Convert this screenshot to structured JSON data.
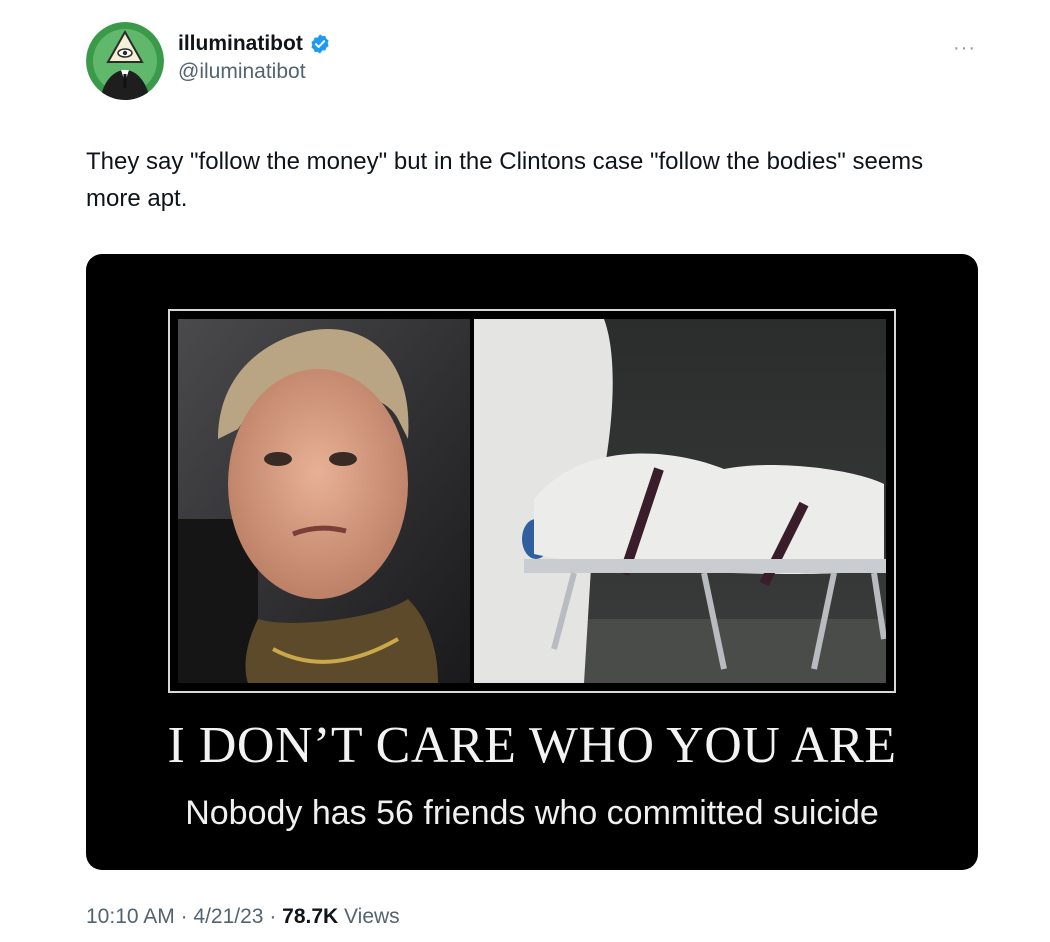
{
  "author": {
    "display_name": "illuminatibot",
    "handle": "@iluminatibot",
    "verified": true,
    "avatar_icon": "illuminati-eye-pyramid-icon"
  },
  "menu": {
    "more_label": "···"
  },
  "tweet": {
    "text": "They say \"follow the money\" but in the Clintons case \"follow the bodies\" seems more apt."
  },
  "media": {
    "headline": "I DON’T CARE WHO YOU ARE",
    "subline": "Nobody has 56 friends who committed suicide"
  },
  "meta": {
    "time": "10:10 AM",
    "sep1": " · ",
    "date": "4/21/23",
    "sep2": " · ",
    "views_count": "78.7K",
    "views_label": " Views"
  },
  "colors": {
    "verified_blue": "#1d9bf0",
    "avatar_green": "#3b9a4a",
    "text_primary": "#0f1419",
    "text_secondary": "#536471"
  }
}
